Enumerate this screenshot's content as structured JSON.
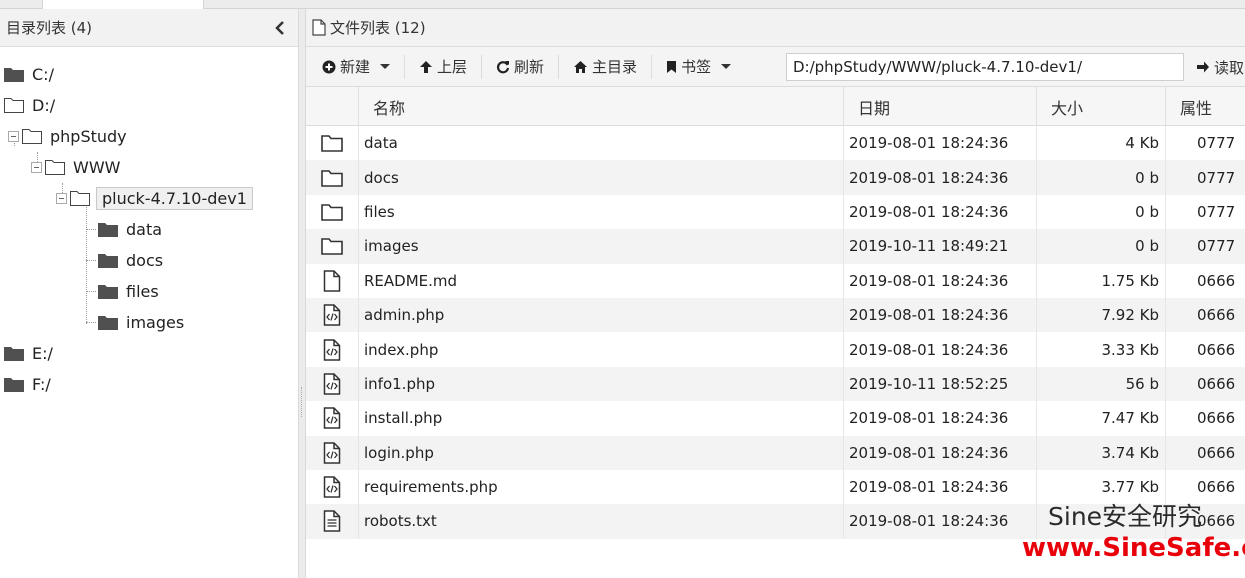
{
  "left_panel": {
    "title": "目录列表 (4)",
    "tree": [
      {
        "label": "C:/",
        "kind": "drive"
      },
      {
        "label": "D:/",
        "kind": "drive-open"
      },
      {
        "label": "phpStudy",
        "kind": "folder-open"
      },
      {
        "label": "WWW",
        "kind": "folder-open"
      },
      {
        "label": "pluck-4.7.10-dev1",
        "kind": "folder-open-selected"
      },
      {
        "label": "data",
        "kind": "folder"
      },
      {
        "label": "docs",
        "kind": "folder"
      },
      {
        "label": "files",
        "kind": "folder"
      },
      {
        "label": "images",
        "kind": "folder"
      },
      {
        "label": "E:/",
        "kind": "drive"
      },
      {
        "label": "F:/",
        "kind": "drive"
      }
    ]
  },
  "right_panel": {
    "title": "文件列表 (12)",
    "toolbar": {
      "new_label": "新建",
      "up_label": "上层",
      "refresh_label": "刷新",
      "home_label": "主目录",
      "bookmark_label": "书签",
      "path_value": "D:/phpStudy/WWW/pluck-4.7.10-dev1/",
      "read_label": "读取"
    },
    "columns": {
      "name": "名称",
      "date": "日期",
      "size": "大小",
      "attr": "属性"
    },
    "files": [
      {
        "icon": "folder-icon",
        "name": "data",
        "date": "2019-08-01 18:24:36",
        "size": "4 Kb",
        "attr": "0777"
      },
      {
        "icon": "folder-icon",
        "name": "docs",
        "date": "2019-08-01 18:24:36",
        "size": "0 b",
        "attr": "0777"
      },
      {
        "icon": "folder-icon",
        "name": "files",
        "date": "2019-08-01 18:24:36",
        "size": "0 b",
        "attr": "0777"
      },
      {
        "icon": "folder-icon",
        "name": "images",
        "date": "2019-10-11 18:49:21",
        "size": "0 b",
        "attr": "0777"
      },
      {
        "icon": "file-icon",
        "name": "README.md",
        "date": "2019-08-01 18:24:36",
        "size": "1.75 Kb",
        "attr": "0666"
      },
      {
        "icon": "code-file-icon",
        "name": "admin.php",
        "date": "2019-08-01 18:24:36",
        "size": "7.92 Kb",
        "attr": "0666"
      },
      {
        "icon": "code-file-icon",
        "name": "index.php",
        "date": "2019-08-01 18:24:36",
        "size": "3.33 Kb",
        "attr": "0666"
      },
      {
        "icon": "code-file-icon",
        "name": "info1.php",
        "date": "2019-10-11 18:52:25",
        "size": "56 b",
        "attr": "0666"
      },
      {
        "icon": "code-file-icon",
        "name": "install.php",
        "date": "2019-08-01 18:24:36",
        "size": "7.47 Kb",
        "attr": "0666"
      },
      {
        "icon": "code-file-icon",
        "name": "login.php",
        "date": "2019-08-01 18:24:36",
        "size": "3.74 Kb",
        "attr": "0666"
      },
      {
        "icon": "code-file-icon",
        "name": "requirements.php",
        "date": "2019-08-01 18:24:36",
        "size": "3.77 Kb",
        "attr": "0666"
      },
      {
        "icon": "text-file-icon",
        "name": "robots.txt",
        "date": "2019-08-01 18:24:36",
        "size": "",
        "attr": "0666"
      }
    ]
  },
  "watermark": {
    "line1": "Sine安全研究",
    "line2": "www.SineSafe.com"
  }
}
